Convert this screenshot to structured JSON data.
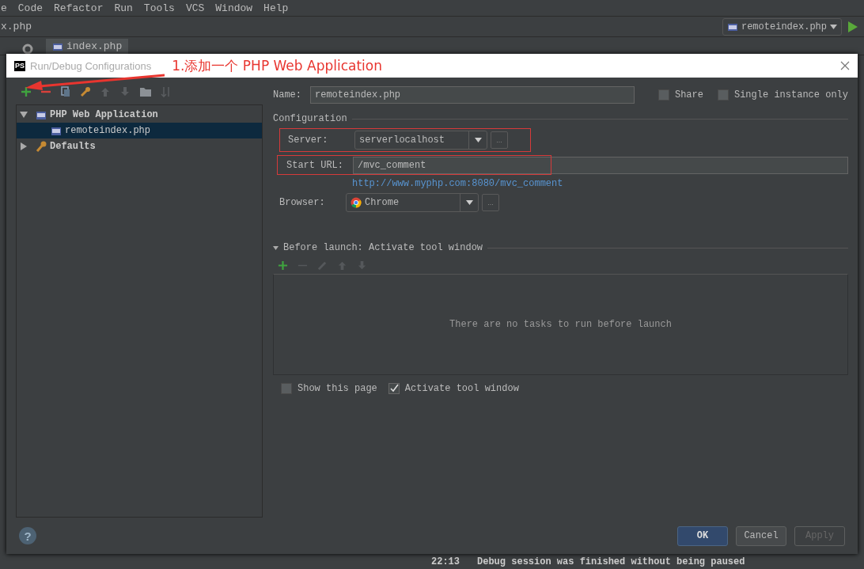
{
  "menu": [
    {
      "label": "e"
    },
    {
      "label": "Code"
    },
    {
      "label": "Refactor"
    },
    {
      "label": "Run"
    },
    {
      "label": "Tools"
    },
    {
      "label": "VCS"
    },
    {
      "label": "Window"
    },
    {
      "label": "Help"
    }
  ],
  "breadcrumb": "x.php",
  "editor_tabs": [
    {
      "label": "index.php",
      "selected": true
    }
  ],
  "run_config": {
    "value": "remoteindex.php"
  },
  "dialog": {
    "title": "Run/Debug Configurations",
    "logo": "PS"
  },
  "annotation": {
    "text": "1.添加一个 PHP Web Application"
  },
  "tree": [
    {
      "label": "PHP Web Application",
      "expanded": true,
      "children": [
        {
          "label": "remoteindex.php",
          "selected": true
        }
      ]
    },
    {
      "label": "Defaults",
      "expanded": false
    }
  ],
  "name": {
    "label": "Name:",
    "value": "remoteindex.php"
  },
  "share": {
    "label": "Share",
    "checked": false
  },
  "single_instance": {
    "label": "Single instance only",
    "checked": false
  },
  "configuration": {
    "title": "Configuration",
    "server": {
      "label": "Server:",
      "value": "serverlocalhost"
    },
    "start_url": {
      "label": "Start URL:",
      "value": "/mvc_comment"
    },
    "url_link": "http://www.myphp.com:8080/mvc_comment",
    "browser": {
      "label": "Browser:",
      "value": "Chrome"
    },
    "server_browse": "...",
    "browser_browse": "..."
  },
  "before_launch": {
    "title": "Before launch: Activate tool window",
    "expanded": true,
    "empty_text": "There are no tasks to run before launch"
  },
  "show_this_page": {
    "label": "Show this page",
    "checked": false
  },
  "activate_tool_window": {
    "label": "Activate tool window",
    "checked": true
  },
  "help": "?",
  "buttons": [
    {
      "label": "OK",
      "kind": "primary"
    },
    {
      "label": "Cancel",
      "kind": "normal"
    },
    {
      "label": "Apply",
      "kind": "disabled"
    }
  ],
  "log": {
    "time": "22:13",
    "message": "Debug session was finished without being paused"
  }
}
